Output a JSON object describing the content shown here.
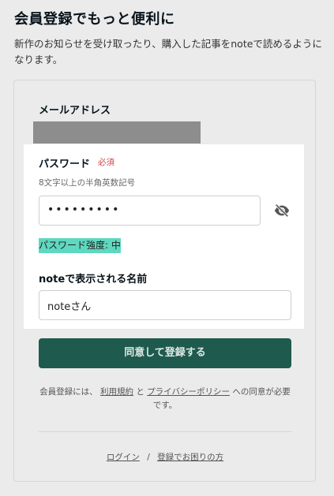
{
  "header": {
    "title": "会員登録でもっと便利に",
    "description": "新作のお知らせを受け取ったり、購入した記事をnoteで読めるようになります。"
  },
  "form": {
    "email_label": "メールアドレス",
    "password_label": "パスワード",
    "required_badge": "必須",
    "password_hint": "8文字以上の半角英数記号",
    "password_value": "•••••••••",
    "password_strength": "パスワード強度: 中",
    "display_name_label": "noteで表示される名前",
    "display_name_value": "noteさん",
    "submit_label": "同意して登録する"
  },
  "terms": {
    "prefix": "会員登録には、",
    "terms_link": "利用規約",
    "and": "と",
    "privacy_link": "プライバシーポリシー",
    "suffix": "への同意が必要です。"
  },
  "footer": {
    "login_link": "ログイン",
    "separator": "/",
    "help_link": "登録でお困りの方"
  },
  "icons": {
    "toggle_visibility": "eye-off-icon"
  },
  "colors": {
    "accent": "#1e5a4d",
    "strength": "#5fd8c0",
    "required": "#d0464a"
  }
}
